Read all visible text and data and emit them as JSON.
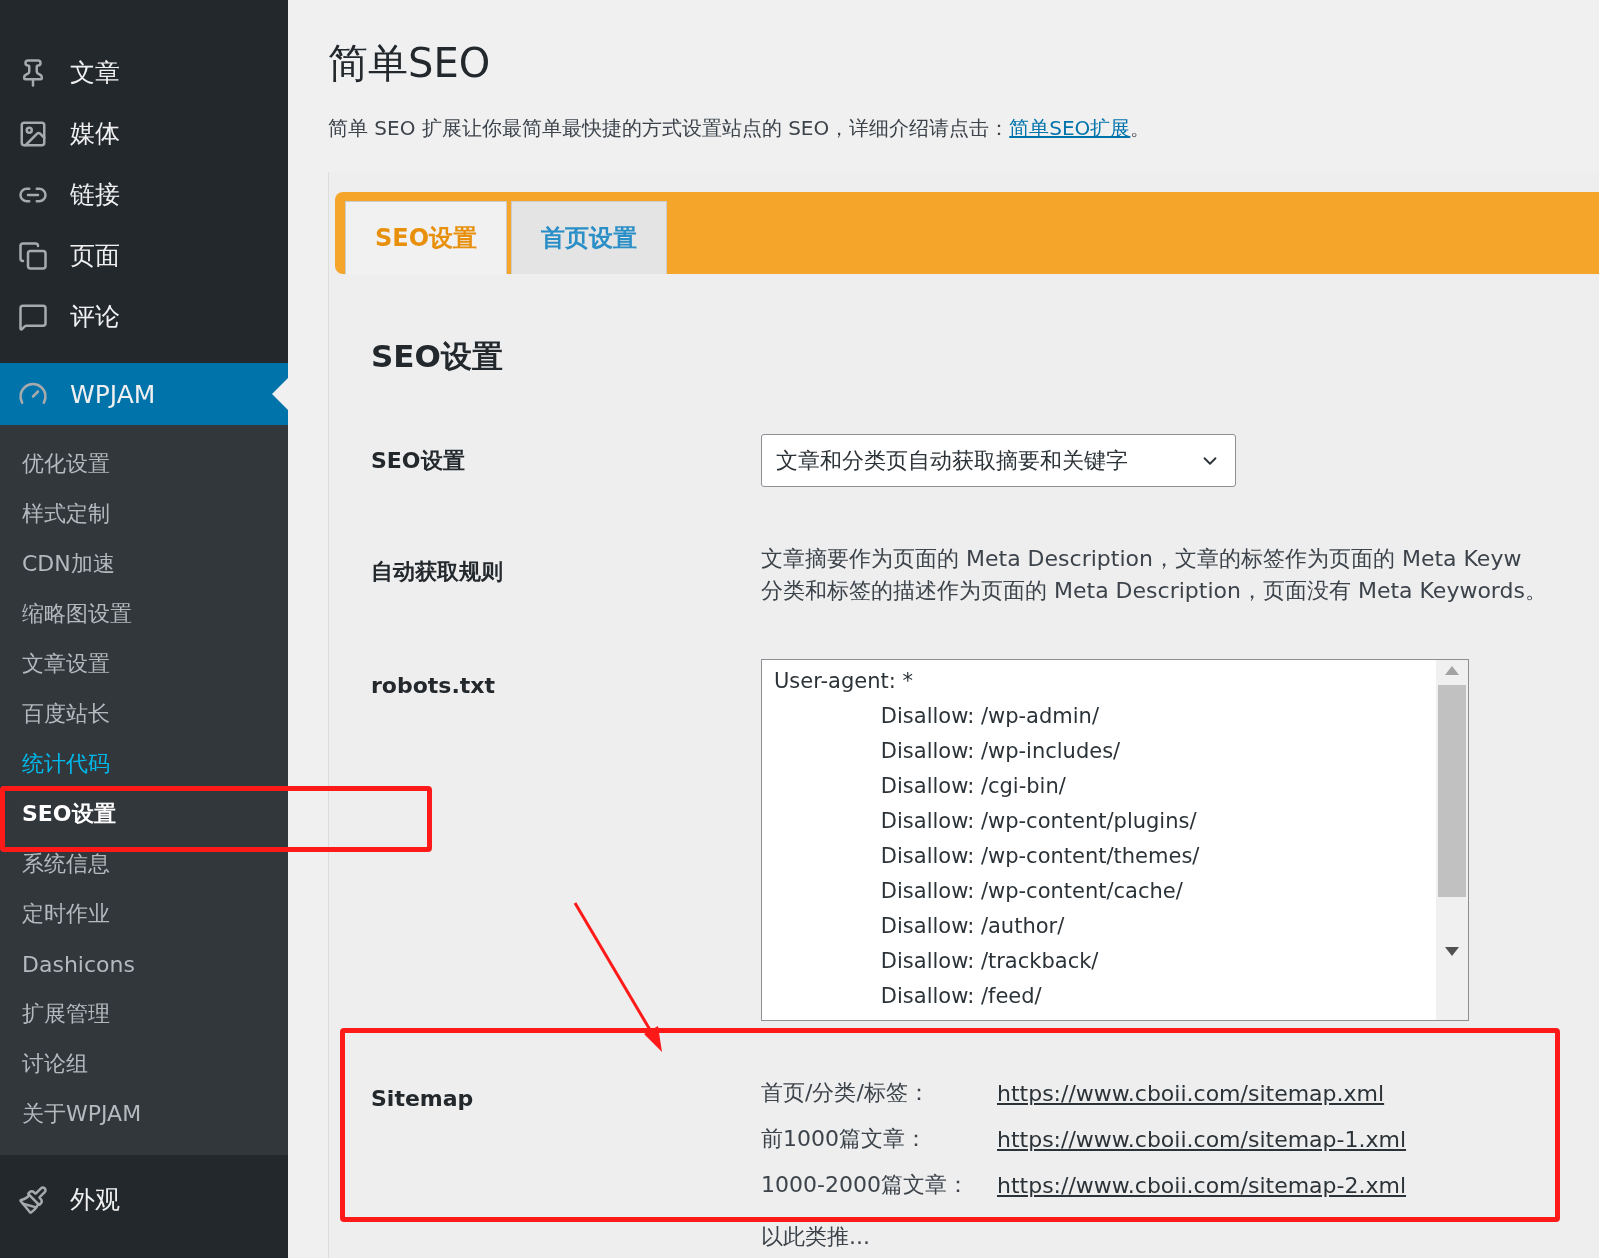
{
  "sidebar": {
    "items": [
      {
        "label": "文章",
        "selected": false
      },
      {
        "label": "媒体",
        "selected": false
      },
      {
        "label": "链接",
        "selected": false
      },
      {
        "label": "页面",
        "selected": false
      },
      {
        "label": "评论",
        "selected": false
      },
      {
        "label": "WPJAM",
        "selected": true,
        "children": [
          {
            "label": "优化设置",
            "selected": false,
            "highlighted": false
          },
          {
            "label": "样式定制",
            "selected": false,
            "highlighted": false
          },
          {
            "label": "CDN加速",
            "selected": false,
            "highlighted": false
          },
          {
            "label": "缩略图设置",
            "selected": false,
            "highlighted": false
          },
          {
            "label": "文章设置",
            "selected": false,
            "highlighted": false
          },
          {
            "label": "百度站长",
            "selected": false,
            "highlighted": false
          },
          {
            "label": "统计代码",
            "selected": false,
            "highlighted": true
          },
          {
            "label": "SEO设置",
            "selected": true,
            "highlighted": false
          },
          {
            "label": "系统信息",
            "selected": false,
            "highlighted": false
          },
          {
            "label": "定时作业",
            "selected": false,
            "highlighted": false
          },
          {
            "label": "Dashicons",
            "selected": false,
            "highlighted": false
          },
          {
            "label": "扩展管理",
            "selected": false,
            "highlighted": false
          },
          {
            "label": "讨论组",
            "selected": false,
            "highlighted": false
          },
          {
            "label": "关于WPJAM",
            "selected": false,
            "highlighted": false
          }
        ]
      },
      {
        "label": "外观",
        "selected": false
      }
    ]
  },
  "page": {
    "title": "简单SEO",
    "description": "简单 SEO 扩展让你最简单最快捷的方式设置站点的 SEO，详细介绍请点击：",
    "description_link": "简单SEO扩展",
    "description_end": "。"
  },
  "tabs": [
    {
      "label": "SEO设置",
      "selected": true
    },
    {
      "label": "首页设置",
      "selected": false
    }
  ],
  "section_title": "SEO设置",
  "form": {
    "seo_mode": {
      "label": "SEO设置",
      "value": "文章和分类页自动获取摘要和关键字"
    },
    "auto_rule": {
      "label": "自动获取规则",
      "lines": [
        "文章摘要作为页面的 Meta Description，文章的标签作为页面的 Meta Keyw",
        "分类和标签的描述作为页面的 Meta Description，页面没有 Meta Keywords。"
      ]
    },
    "robots": {
      "label": "robots.txt",
      "value": "User-agent: *\n\t\t\t\tDisallow: /wp-admin/\n\t\t\t\tDisallow: /wp-includes/\n\t\t\t\tDisallow: /cgi-bin/\n\t\t\t\tDisallow: /wp-content/plugins/\n\t\t\t\tDisallow: /wp-content/themes/\n\t\t\t\tDisallow: /wp-content/cache/\n\t\t\t\tDisallow: /author/\n\t\t\t\tDisallow: /trackback/\n\t\t\t\tDisallow: /feed/"
    },
    "sitemap": {
      "label": "Sitemap",
      "rows": [
        {
          "label": "首页/分类/标签：",
          "url": "https://www.cboii.com/sitemap.xml"
        },
        {
          "label": "前1000篇文章：",
          "url": "https://www.cboii.com/sitemap-1.xml"
        },
        {
          "label": "1000-2000篇文章：",
          "url": "https://www.cboii.com/sitemap-2.xml"
        }
      ],
      "note": "以此类推..."
    }
  }
}
